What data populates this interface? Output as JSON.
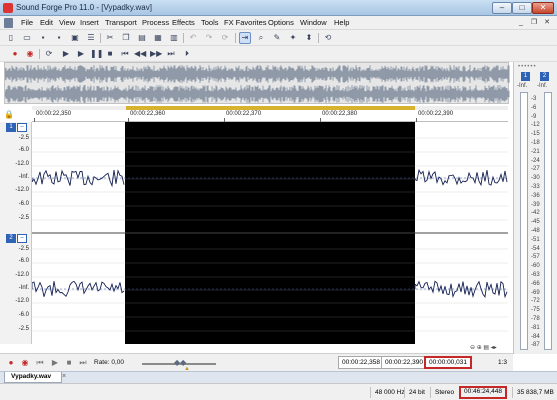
{
  "window": {
    "title": "Sound Forge Pro 11.0 - [Vypadky.wav]"
  },
  "menu": [
    "File",
    "Edit",
    "View",
    "Insert",
    "Transport",
    "Process",
    "Effects",
    "Tools",
    "FX Favorites",
    "Options",
    "Window",
    "Help"
  ],
  "toolbar1": {
    "icons": [
      "new-icon",
      "open-icon",
      "save-icon",
      "save-as-icon",
      "render-icon",
      "properties-icon",
      "open-project-icon",
      "cut-icon",
      "copy-icon",
      "paste-icon",
      "mix-icon",
      "crop-icon",
      "trim-icon",
      "undo-icon",
      "redo-icon",
      "repeat-icon",
      "edit-tool-icon",
      "magnify-tool-icon",
      "pencil-tool-icon",
      "envelope-tool-icon",
      "event-tool-icon",
      "snap-icon"
    ]
  },
  "toolbar2": {
    "icons": [
      "record-icon",
      "record-stop-icon",
      "loop-icon",
      "play-icon",
      "play-all-icon",
      "pause-icon",
      "stop-icon",
      "go-to-start-icon",
      "rewind-icon",
      "fast-forward-icon",
      "go-to-end-icon",
      "play-cursor-icon"
    ]
  },
  "meter": {
    "labels": [
      "-Inf.",
      "-Inf."
    ],
    "channels": [
      "1",
      "2"
    ],
    "scale": [
      "-3",
      "-6",
      "-9",
      "-12",
      "-15",
      "-18",
      "-21",
      "-24",
      "-27",
      "-30",
      "-33",
      "-36",
      "-39",
      "-42",
      "-45",
      "-48",
      "-51",
      "-54",
      "-57",
      "-60",
      "-63",
      "-66",
      "-69",
      "-72",
      "-75",
      "-78",
      "-81",
      "-84",
      "-87"
    ]
  },
  "ruler": [
    "00:00:22,350",
    "00:00:22,360",
    "00:00:22,370",
    "00:00:22,380",
    "00:00:22,390"
  ],
  "channels": [
    {
      "number": "1",
      "scale": [
        "-2.5",
        "-6.0",
        "-12.0",
        "-Inf.",
        "-12.0",
        "-6.0",
        "-2.5"
      ]
    },
    {
      "number": "2",
      "scale": [
        "-2.5",
        "-6.0",
        "-12.0",
        "-Inf.",
        "-12.0",
        "-6.0",
        "-2.5"
      ]
    }
  ],
  "transport": {
    "rate": "Rate: 0,00",
    "selection_start": "00:00:22,358",
    "selection_end": "00:00:22,390",
    "selection_length": "00:00:00,031",
    "zoom": "1:3"
  },
  "tab": {
    "name": "Vypadky.wav",
    "close": "×"
  },
  "status": {
    "sample_rate": "48 000 Hz",
    "bit_depth": "24 bit",
    "channels": "Stereo",
    "length": "00:46:24,448",
    "size": "35 838,7 MB"
  },
  "colors": {
    "selection": "#000000",
    "waveform": "#141e50",
    "highlight_box": "#c62828",
    "channel_badge": "#2f63b6"
  }
}
